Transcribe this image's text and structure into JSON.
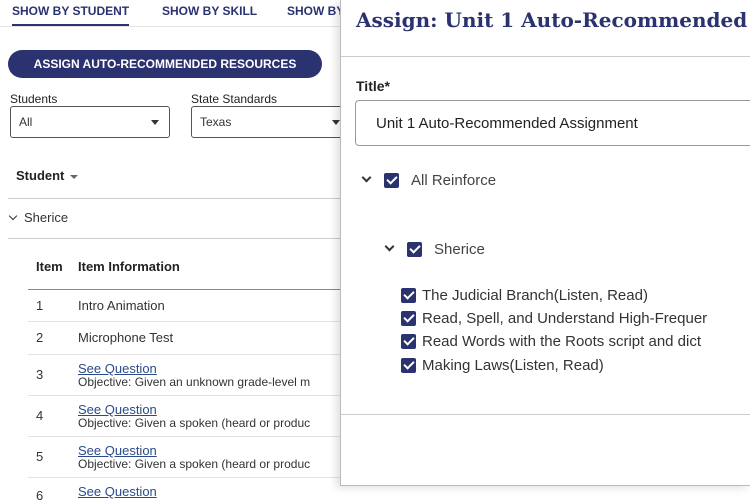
{
  "tabs": [
    "SHOW BY STUDENT",
    "SHOW BY SKILL",
    "SHOW BY"
  ],
  "assign_button": "ASSIGN AUTO-RECOMMENDED RESOURCES",
  "filters": {
    "students_label": "Students",
    "students_value": "All",
    "standards_label": "State Standards",
    "standards_value": "Texas"
  },
  "student_header": "Student",
  "student_group": "Sherice",
  "table": {
    "col_item": "Item",
    "col_info": "Item Information",
    "rows": [
      {
        "num": "1",
        "info": "Intro Animation"
      },
      {
        "num": "2",
        "info": "Microphone Test"
      },
      {
        "num": "3",
        "link": "See Question",
        "objective": "Objective: Given an unknown grade-level m"
      },
      {
        "num": "4",
        "link": "See Question",
        "objective": "Objective: Given a spoken (heard or produc"
      },
      {
        "num": "5",
        "link": "See Question",
        "objective": "Objective: Given a spoken (heard or produc"
      },
      {
        "num": "6",
        "link": "See Question"
      }
    ]
  },
  "modal": {
    "title": "Assign: Unit 1 Auto-Recommended",
    "field_label": "Title*",
    "title_value": "Unit 1 Auto-Recommended Assignment",
    "tree": {
      "root": "All Reinforce",
      "student": "Sherice",
      "items": [
        "The Judicial Branch(Listen, Read)",
        "Read, Spell, and Understand High-Frequer",
        "Read Words with the Roots script and dict",
        "Making Laws(Listen, Read)"
      ]
    }
  },
  "colors": {
    "brand": "#2a3270",
    "link": "#2a4a8a"
  }
}
